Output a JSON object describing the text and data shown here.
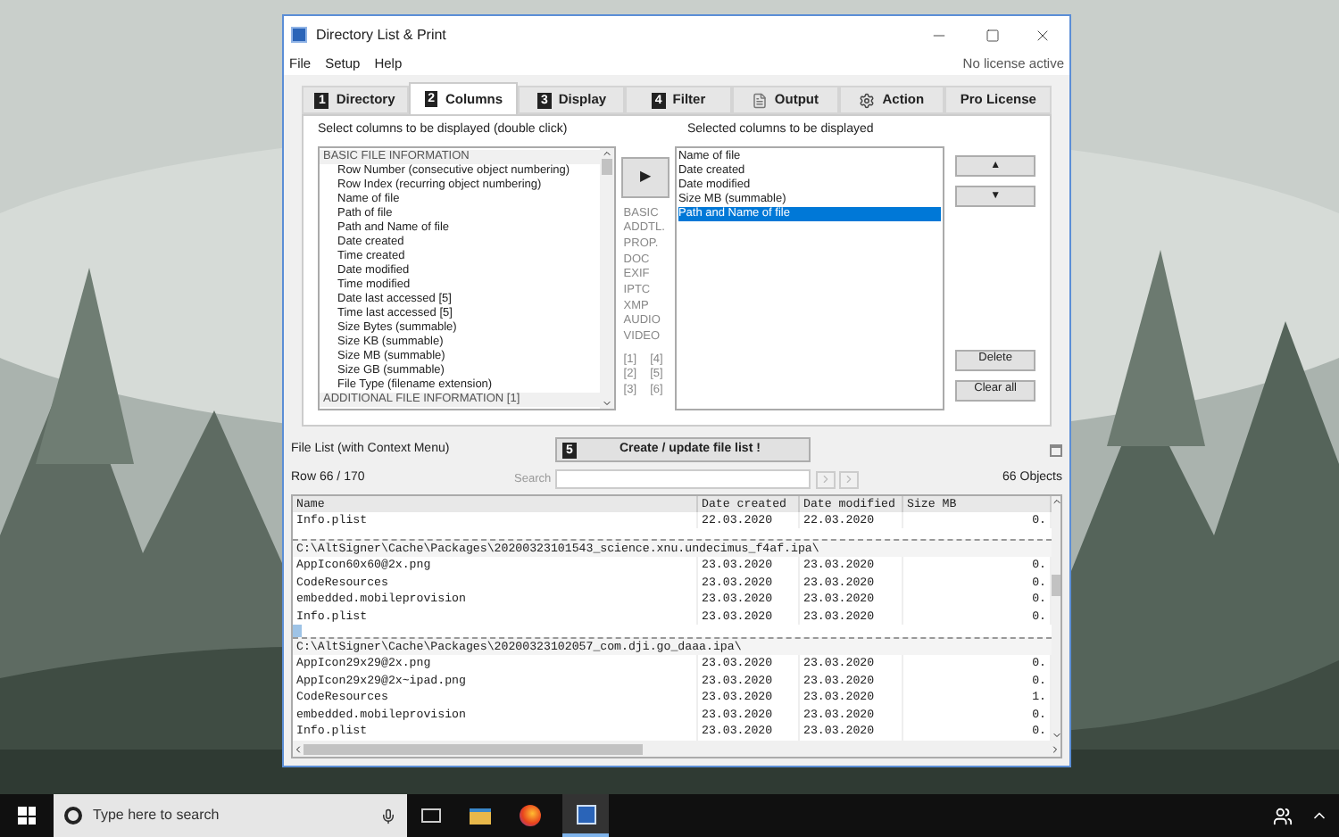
{
  "window": {
    "title": "Directory List & Print",
    "license_status": "No license active"
  },
  "menu": [
    "File",
    "Setup",
    "Help"
  ],
  "tabs": [
    {
      "kind": "numbered",
      "badge": "1",
      "label": "Directory",
      "selected": false
    },
    {
      "kind": "numbered",
      "badge": "2",
      "label": "Columns",
      "selected": true
    },
    {
      "kind": "numbered",
      "badge": "3",
      "label": "Display",
      "selected": false
    },
    {
      "kind": "numbered",
      "badge": "4",
      "label": "Filter",
      "selected": false
    },
    {
      "kind": "document",
      "label": "Output",
      "selected": false
    },
    {
      "kind": "gear",
      "label": "Action",
      "selected": false
    },
    {
      "kind": "plain",
      "label": "Pro License",
      "selected": false
    }
  ],
  "available_columns": {
    "label": "Select columns to be displayed (double click)",
    "items": [
      {
        "kind": "group",
        "text": "BASIC FILE INFORMATION"
      },
      {
        "kind": "item",
        "text": "Row Number  (consecutive object numbering)"
      },
      {
        "kind": "item",
        "text": "Row Index  (recurring object numbering)"
      },
      {
        "kind": "item",
        "text": "Name of file"
      },
      {
        "kind": "item",
        "text": "Path of file"
      },
      {
        "kind": "item",
        "text": "Path and Name of file"
      },
      {
        "kind": "item",
        "text": "Date created"
      },
      {
        "kind": "item",
        "text": "Time created"
      },
      {
        "kind": "item",
        "text": "Date modified"
      },
      {
        "kind": "item",
        "text": "Time modified"
      },
      {
        "kind": "item",
        "text": "Date last accessed [5]"
      },
      {
        "kind": "item",
        "text": "Time last accessed [5]"
      },
      {
        "kind": "item",
        "text": "Size Bytes  (summable)"
      },
      {
        "kind": "item",
        "text": "Size KB  (summable)"
      },
      {
        "kind": "item",
        "text": "Size MB  (summable)"
      },
      {
        "kind": "item",
        "text": "Size GB  (summable)"
      },
      {
        "kind": "item",
        "text": "File Type  (filename extension)"
      },
      {
        "kind": "group",
        "text": "ADDITIONAL FILE INFORMATION [1]"
      }
    ]
  },
  "add_button": "▶",
  "categories": [
    "BASIC",
    "ADDTL.",
    "PROP.",
    "DOC",
    "EXIF",
    "IPTC",
    "XMP",
    "AUDIO",
    "VIDEO"
  ],
  "pages": [
    "[1]",
    "[4]",
    "[2]",
    "[5]",
    "[3]",
    "[6]"
  ],
  "selected_columns": {
    "label": "Selected columns to be displayed",
    "items": [
      {
        "text": "Name of file",
        "selected": false
      },
      {
        "text": "Date created",
        "selected": false
      },
      {
        "text": "Date modified",
        "selected": false
      },
      {
        "text": "Size MB  (summable)",
        "selected": false
      },
      {
        "text": "Path and Name of file",
        "selected": true
      }
    ]
  },
  "move_buttons": [
    "▲",
    "▼"
  ],
  "action_buttons": [
    "Delete",
    "Clear all"
  ],
  "file_list": {
    "label": "File List (with Context Menu)",
    "create_button": {
      "badge": "5",
      "label": "Create / update file list !"
    },
    "row_status": "Row 66 / 170",
    "search": {
      "label": "Search"
    },
    "objects": "66 Objects"
  },
  "table": {
    "columns": [
      "Name",
      "Date created",
      "Date modified",
      "Size MB"
    ],
    "rows": [
      {
        "kind": "file",
        "cells": [
          "Info.plist",
          "22.03.2020",
          "22.03.2020",
          "0."
        ]
      },
      {
        "kind": "blank",
        "selected": false
      },
      {
        "kind": "path",
        "path": "C:\\AltSigner\\Cache\\Packages\\20200323101543_science.xnu.undecimus_f4af.ipa\\"
      },
      {
        "kind": "file",
        "cells": [
          "AppIcon60x60@2x.png",
          "23.03.2020",
          "23.03.2020",
          "0."
        ]
      },
      {
        "kind": "file",
        "cells": [
          "CodeResources",
          "23.03.2020",
          "23.03.2020",
          "0."
        ]
      },
      {
        "kind": "file",
        "cells": [
          "embedded.mobileprovision",
          "23.03.2020",
          "23.03.2020",
          "0."
        ]
      },
      {
        "kind": "file",
        "cells": [
          "Info.plist",
          "23.03.2020",
          "23.03.2020",
          "0."
        ]
      },
      {
        "kind": "blank",
        "selected": true
      },
      {
        "kind": "path",
        "path": "C:\\AltSigner\\Cache\\Packages\\20200323102057_com.dji.go_daaa.ipa\\"
      },
      {
        "kind": "file",
        "cells": [
          "AppIcon29x29@2x.png",
          "23.03.2020",
          "23.03.2020",
          "0."
        ]
      },
      {
        "kind": "file",
        "cells": [
          "AppIcon29x29@2x~ipad.png",
          "23.03.2020",
          "23.03.2020",
          "0."
        ]
      },
      {
        "kind": "file",
        "cells": [
          "CodeResources",
          "23.03.2020",
          "23.03.2020",
          "1."
        ]
      },
      {
        "kind": "file",
        "cells": [
          "embedded.mobileprovision",
          "23.03.2020",
          "23.03.2020",
          "0."
        ]
      },
      {
        "kind": "file",
        "cells": [
          "Info.plist",
          "23.03.2020",
          "23.03.2020",
          "0."
        ]
      }
    ]
  },
  "taskbar": {
    "search": {
      "placeholder": "Type here to search"
    }
  }
}
